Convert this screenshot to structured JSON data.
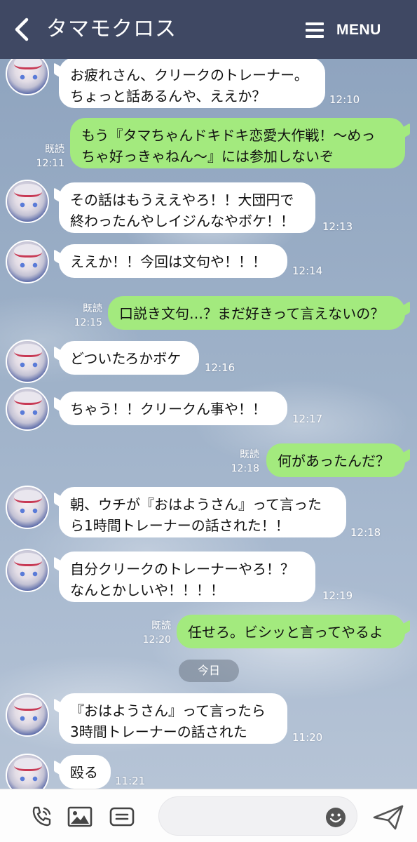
{
  "header": {
    "title": "タマモクロス",
    "menu_label": "MENU"
  },
  "date_separator": "今日",
  "messages": [
    {
      "side": "in",
      "text": "お疲れさん、クリークのトレーナー。\nちょっと話あるんや、ええか？",
      "time": "12:10"
    },
    {
      "side": "out",
      "text": "もう『タマちゃんドキドキ恋愛大作戦！〜めっ\nちゃ好っきゃねん〜』には参加しないぞ",
      "time": "12:11",
      "read": "既読"
    },
    {
      "side": "in",
      "text": "その話はもうええやろ！！大団円で\n終わったんやしイジんなやボケ！！",
      "time": "12:13"
    },
    {
      "side": "in",
      "text": "ええか！！今回は文句や！！！",
      "time": "12:14"
    },
    {
      "side": "out",
      "text": "口説き文句…？まだ好きって言えないの？",
      "time": "12:15",
      "read": "既読"
    },
    {
      "side": "in",
      "text": "どついたろかボケ",
      "time": "12:16"
    },
    {
      "side": "in",
      "text": "ちゃう！！クリークん事や！！",
      "time": "12:17"
    },
    {
      "side": "out",
      "text": "何があったんだ？",
      "time": "12:18",
      "read": "既読"
    },
    {
      "side": "in",
      "text": "朝、ウチが『おはようさん』って言った\nら1時間トレーナーの話された！！",
      "time": "12:18"
    },
    {
      "side": "in",
      "text": "自分クリークのトレーナーやろ！？\nなんとかしいや！！！！",
      "time": "12:19"
    },
    {
      "side": "out",
      "text": "任せろ。ビシッと言ってやるよ",
      "time": "12:20",
      "read": "既読"
    },
    {
      "side": "in",
      "text": "『おはようさん』って言ったら\n3時間トレーナーの話された",
      "time": "11:20"
    },
    {
      "side": "in",
      "text": "殴る",
      "time": "11:21"
    }
  ],
  "icons": {
    "back": "chevron-left-icon",
    "menu": "hamburger-icon",
    "call": "phone-icon",
    "image": "image-icon",
    "more": "menu-box-icon",
    "emoji": "smiley-icon",
    "send": "send-icon"
  },
  "colors": {
    "header_bg": "#3f4863",
    "bubble_out": "#a3ea7e",
    "bubble_in": "#ffffff"
  }
}
